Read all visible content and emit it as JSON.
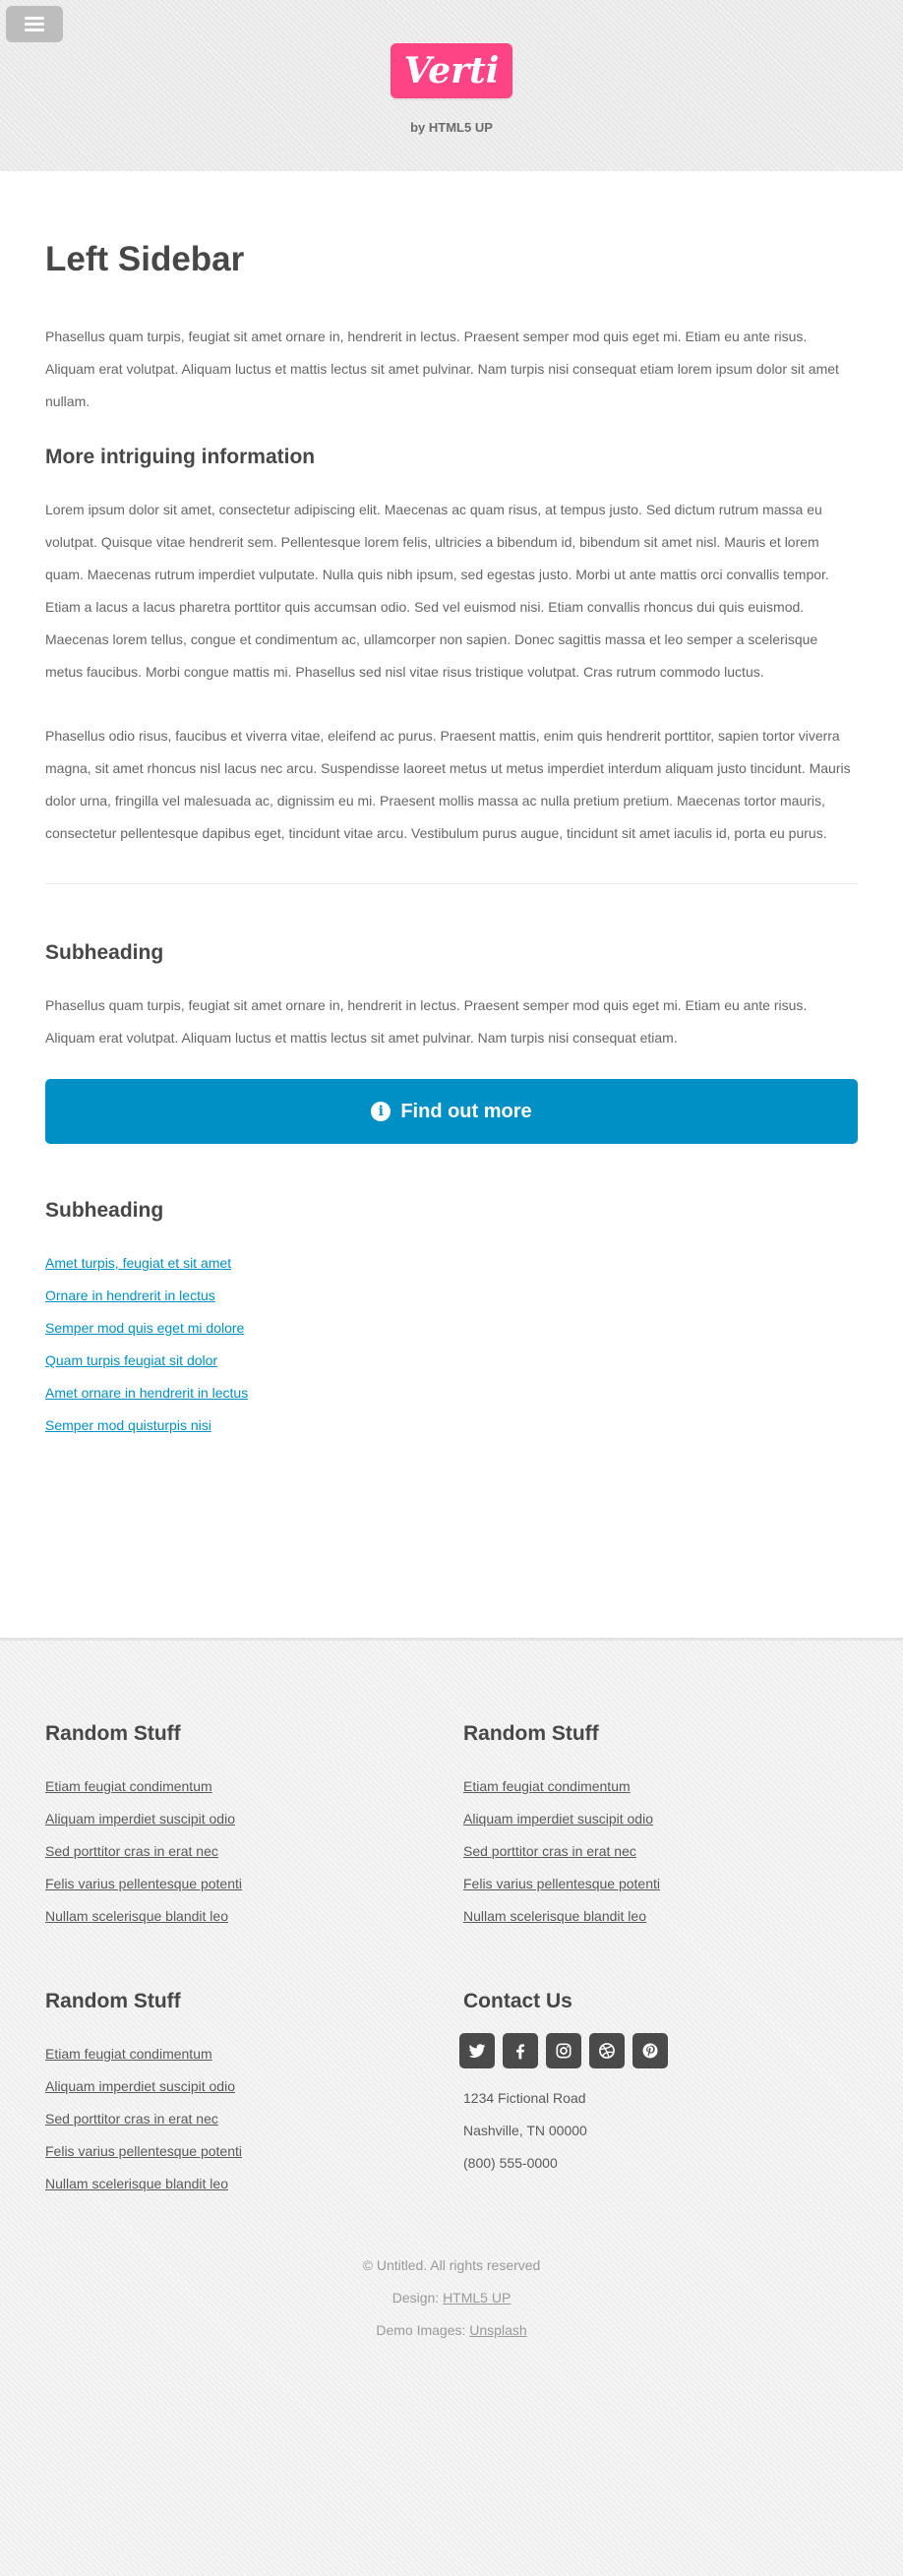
{
  "header": {
    "logo": "Verti",
    "tagline": "by HTML5 UP"
  },
  "main": {
    "title": "Left Sidebar",
    "intro": "Phasellus quam turpis, feugiat sit amet ornare in, hendrerit in lectus. Praesent semper mod quis eget mi. Etiam eu ante risus. Aliquam erat volutpat. Aliquam luctus et mattis lectus sit amet pulvinar. Nam turpis nisi consequat etiam lorem ipsum dolor sit amet nullam.",
    "section_heading": "More intriguing information",
    "para1": "Lorem ipsum dolor sit amet, consectetur adipiscing elit. Maecenas ac quam risus, at tempus justo. Sed dictum rutrum massa eu volutpat. Quisque vitae hendrerit sem. Pellentesque lorem felis, ultricies a bibendum id, bibendum sit amet nisl. Mauris et lorem quam. Maecenas rutrum imperdiet vulputate. Nulla quis nibh ipsum, sed egestas justo. Morbi ut ante mattis orci convallis tempor. Etiam a lacus a lacus pharetra porttitor quis accumsan odio. Sed vel euismod nisi. Etiam convallis rhoncus dui quis euismod. Maecenas lorem tellus, congue et condimentum ac, ullamcorper non sapien. Donec sagittis massa et leo semper a scelerisque metus faucibus. Morbi congue mattis mi. Phasellus sed nisl vitae risus tristique volutpat. Cras rutrum commodo luctus.",
    "para2": "Phasellus odio risus, faucibus et viverra vitae, eleifend ac purus. Praesent mattis, enim quis hendrerit porttitor, sapien tortor viverra magna, sit amet rhoncus nisl lacus nec arcu. Suspendisse laoreet metus ut metus imperdiet interdum aliquam justo tincidunt. Mauris dolor urna, fringilla vel malesuada ac, dignissim eu mi. Praesent mollis massa ac nulla pretium pretium. Maecenas tortor mauris, consectetur pellentesque dapibus eget, tincidunt vitae arcu. Vestibulum purus augue, tincidunt sit amet iaculis id, porta eu purus."
  },
  "sidebar": {
    "heading1": "Subheading",
    "text": "Phasellus quam turpis, feugiat sit amet ornare in, hendrerit in lectus. Praesent semper mod quis eget mi. Etiam eu ante risus. Aliquam erat volutpat. Aliquam luctus et mattis lectus sit amet pulvinar. Nam turpis nisi consequat etiam.",
    "button_label": "Find out more",
    "heading2": "Subheading",
    "links": [
      "Amet turpis, feugiat et sit amet",
      "Ornare in hendrerit in lectus",
      "Semper mod quis eget mi dolore",
      "Quam turpis feugiat sit dolor",
      "Amet ornare in hendrerit in lectus",
      "Semper mod quisturpis nisi"
    ]
  },
  "footer": {
    "col1": {
      "heading": "Random Stuff",
      "links": [
        "Etiam feugiat condimentum",
        "Aliquam imperdiet suscipit odio",
        "Sed porttitor cras in erat nec",
        "Felis varius pellentesque potenti",
        "Nullam scelerisque blandit leo"
      ]
    },
    "col2": {
      "heading": "Random Stuff",
      "links": [
        "Etiam feugiat condimentum",
        "Aliquam imperdiet suscipit odio",
        "Sed porttitor cras in erat nec",
        "Felis varius pellentesque potenti",
        "Nullam scelerisque blandit leo"
      ]
    },
    "col3": {
      "heading": "Random Stuff",
      "links": [
        "Etiam feugiat condimentum",
        "Aliquam imperdiet suscipit odio",
        "Sed porttitor cras in erat nec",
        "Felis varius pellentesque potenti",
        "Nullam scelerisque blandit leo"
      ]
    },
    "contact": {
      "heading": "Contact Us",
      "social_icons": [
        "twitter-icon",
        "facebook-icon",
        "instagram-icon",
        "dribbble-icon",
        "pinterest-icon"
      ],
      "address1": "1234 Fictional Road",
      "address2": "Nashville, TN 00000",
      "phone": "(800) 555-0000"
    },
    "copyright": "© Untitled. All rights reserved",
    "design_label": "Design:",
    "design_link": "HTML5 UP",
    "images_label": "Demo Images:",
    "images_link": "Unsplash"
  },
  "colors": {
    "logo_bg": "#ff4486",
    "button_bg": "#0090c5",
    "link": "#0090c5",
    "heading": "#474747"
  }
}
